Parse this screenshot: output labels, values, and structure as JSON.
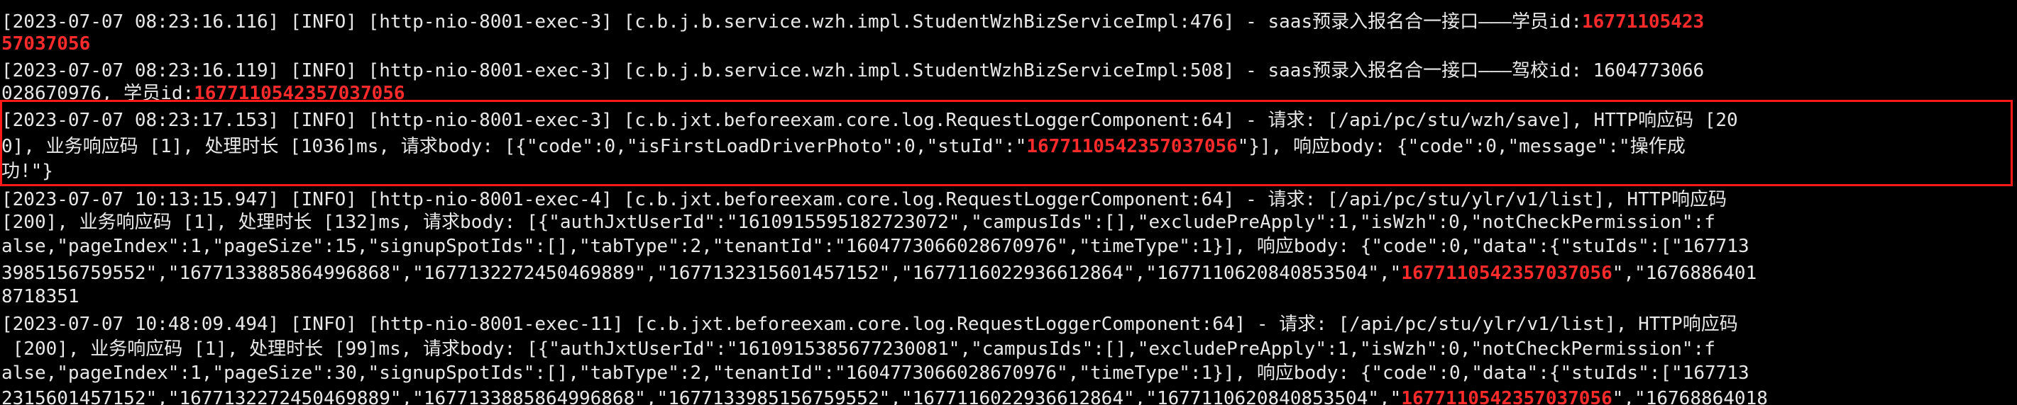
{
  "log_lines": [
    {
      "pre": "[2023-07-07 08:23:16.116] [INFO] [http-nio-8001-exec-3] [c.b.j.b.service.wzh.impl.StudentWzhBizServiceImpl:476] - saas预录入报名合一接口———学员id:",
      "red": "16771105423",
      "post": ""
    },
    {
      "pre": "",
      "red": "57037056",
      "post": ""
    },
    {
      "pre": "[2023-07-07 08:23:16.119] [INFO] [http-nio-8001-exec-3] [c.b.j.b.service.wzh.impl.StudentWzhBizServiceImpl:508] - saas预录入报名合一接口———驾校id: 1604773066",
      "red": "",
      "post": ""
    },
    {
      "pre": "028670976, 学员id:",
      "red": "1677110542357037056",
      "post": ""
    },
    {
      "pre": "[2023-07-07 08:23:17.153] [INFO] [http-nio-8001-exec-3] [c.b.jxt.beforeexam.core.log.RequestLoggerComponent:64] - 请求: [/api/pc/stu/wzh/save], HTTP响应码 [20",
      "red": "",
      "post": ""
    },
    {
      "pre": "0], 业务响应码 [1], 处理时长 [1036]ms, 请求body: [{\"code\":0,\"isFirstLoadDriverPhoto\":0,\"stuId\":\"",
      "red": "1677110542357037056",
      "post": "\"}], 响应body: {\"code\":0,\"message\":\"操作成"
    },
    {
      "pre": "功!\"}",
      "red": "",
      "post": ""
    },
    {
      "pre": "[2023-07-07 10:13:15.947] [INFO] [http-nio-8001-exec-4] [c.b.jxt.beforeexam.core.log.RequestLoggerComponent:64] - 请求: [/api/pc/stu/ylr/v1/list], HTTP响应码",
      "red": "",
      "post": ""
    },
    {
      "pre": "[200], 业务响应码 [1], 处理时长 [132]ms, 请求body: [{\"authJxtUserId\":\"1610915595182723072\",\"campusIds\":[],\"excludePreApply\":1,\"isWzh\":0,\"notCheckPermission\":f",
      "red": "",
      "post": ""
    },
    {
      "pre": "alse,\"pageIndex\":1,\"pageSize\":15,\"signupSpotIds\":[],\"tabType\":2,\"tenantId\":\"1604773066028670976\",\"timeType\":1}], 响应body: {\"code\":0,\"data\":{\"stuIds\":[\"167713",
      "red": "",
      "post": ""
    },
    {
      "pre": "3985156759552\",\"1677133885864996868\",\"1677132272450469889\",\"1677132315601457152\",\"1677116022936612864\",\"1677110620840853504\",\"",
      "red": "1677110542357037056",
      "post": "\",\"1676886401"
    },
    {
      "pre": "8718351",
      "red": "",
      "post": ""
    },
    {
      "pre": "[2023-07-07 10:48:09.494] [INFO] [http-nio-8001-exec-11] [c.b.jxt.beforeexam.core.log.RequestLoggerComponent:64] - 请求: [/api/pc/stu/ylr/v1/list], HTTP响应码",
      "red": "",
      "post": ""
    },
    {
      "pre": " [200], 业务响应码 [1], 处理时长 [99]ms, 请求body: [{\"authJxtUserId\":\"1610915385677230081\",\"campusIds\":[],\"excludePreApply\":1,\"isWzh\":0,\"notCheckPermission\":f",
      "red": "",
      "post": ""
    },
    {
      "pre": "alse,\"pageIndex\":1,\"pageSize\":30,\"signupSpotIds\":[],\"tabType\":2,\"tenantId\":\"1604773066028670976\",\"timeType\":1}], 响应body: {\"code\":0,\"data\":{\"stuIds\":[\"167713",
      "red": "",
      "post": ""
    },
    {
      "pre": "2315601457152\",\"1677132272450469889\",\"1677133885864996868\",\"1677133985156759552\",\"1677116022936612864\",\"1677110620840853504\",\"",
      "red": "1677110542357037056",
      "post": "\",\"16768864018"
    }
  ],
  "highlight_color": "#ff1a1a",
  "text_color": "#e8e8e8",
  "accent_red": "#ff2b2b",
  "background": "#000000"
}
